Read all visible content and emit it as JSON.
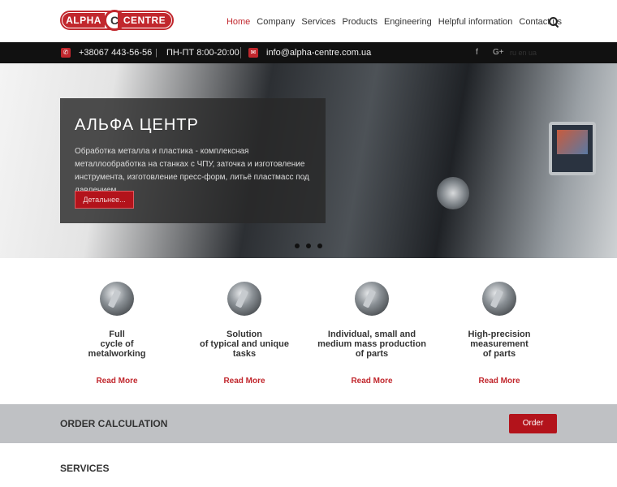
{
  "header": {
    "logo_left": "ALPHA",
    "logo_center": "C",
    "logo_right": "CENTRE",
    "nav": [
      {
        "label": "Home",
        "active": true
      },
      {
        "label": "Company"
      },
      {
        "label": "Services"
      },
      {
        "label": "Products"
      },
      {
        "label": "Engineering"
      },
      {
        "label": "Helpful information"
      },
      {
        "label": "Contact us"
      }
    ],
    "search_icon": "search-icon"
  },
  "topbar": {
    "phone_icon": "phone-icon",
    "phone": "+38067 443-56-56",
    "separator": "|",
    "hours": "ПН-ПТ 8:00-20:00",
    "email_icon": "mail-icon",
    "email": "info@alpha-centre.com.ua",
    "social": [
      {
        "icon": "facebook-icon",
        "glyph": "f"
      },
      {
        "icon": "google-plus-icon",
        "glyph": "G+"
      }
    ],
    "languages": "ru en ua"
  },
  "hero": {
    "title": "АЛЬФА ЦЕНТР",
    "text": "Обработка металла и пластика - комплексная металлообработка на станках с ЧПУ, заточка и изготовление инструмента, изготовление пресс-форм, литьё пластмасс под давлением.",
    "button": "Детальнее...",
    "slide_count": 3
  },
  "features": [
    {
      "title": "Full\ncycle of\nmetalworking",
      "link": "Read More"
    },
    {
      "title": "Solution\nof typical and unique\ntasks",
      "link": "Read More"
    },
    {
      "title": "Individual, small and\nmedium mass production\nof parts",
      "link": "Read More"
    },
    {
      "title": "High-precision\nmeasurement\nof parts",
      "link": "Read More"
    }
  ],
  "order": {
    "title": "ORDER CALCULATION",
    "button": "Order"
  },
  "services": {
    "title": "SERVICES"
  },
  "colors": {
    "accent": "#c1272d",
    "topbar": "#111111",
    "order_bar": "#bfc1c4"
  }
}
